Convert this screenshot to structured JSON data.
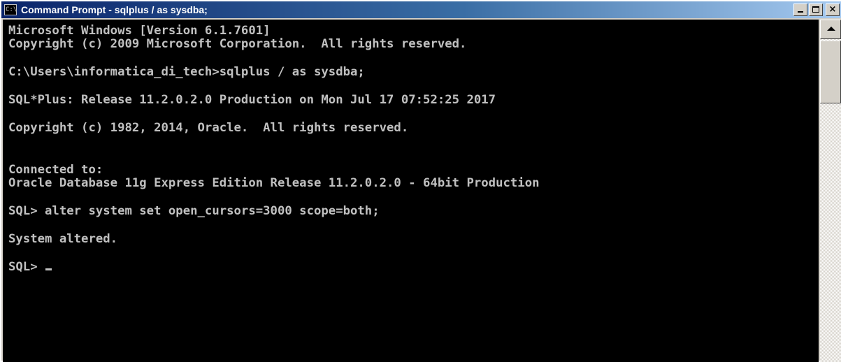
{
  "window": {
    "icon_text": "C:\\",
    "title": "Command Prompt - sqlplus  / as sysdba;"
  },
  "console": {
    "lines": [
      "Microsoft Windows [Version 6.1.7601]",
      "Copyright (c) 2009 Microsoft Corporation.  All rights reserved.",
      "C:\\Users\\informatica_di_tech>sqlplus / as sysdba;",
      "SQL*Plus: Release 11.2.0.2.0 Production on Mon Jul 17 07:52:25 2017",
      "Copyright (c) 1982, 2014, Oracle.  All rights reserved.",
      "Connected to:",
      "Oracle Database 11g Express Edition Release 11.2.0.2.0 - 64bit Production",
      "SQL> alter system set open_cursors=3000 scope=both;",
      "System altered.",
      "SQL> "
    ]
  },
  "colors": {
    "console_background": "#000000",
    "console_text": "#c0c0c0",
    "titlebar_start": "#0a246a",
    "titlebar_end": "#a6caf0",
    "chrome": "#d4d0c8"
  },
  "icons": {
    "window_icon": "command-prompt-icon",
    "minimize": "minimize-icon",
    "maximize": "maximize-icon",
    "close": "close-icon",
    "scroll_up": "scroll-up-arrow-icon"
  }
}
